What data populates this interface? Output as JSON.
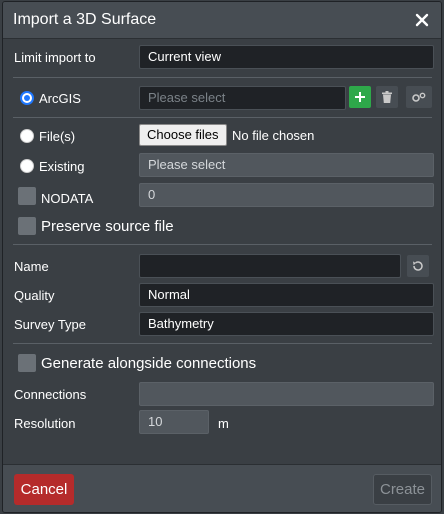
{
  "dialog": {
    "title": "Import a 3D Surface",
    "close_icon": "close-icon"
  },
  "limit_import": {
    "label": "Limit import to",
    "value": "Current view"
  },
  "source": {
    "arcgis": {
      "label": "ArcGIS",
      "placeholder": "Please select",
      "selected": true
    },
    "files": {
      "label": "File(s)",
      "choose_label": "Choose files",
      "status": "No file chosen"
    },
    "existing": {
      "label": "Existing",
      "placeholder": "Please select"
    },
    "nodata": {
      "label": "NODATA",
      "value": "0"
    },
    "preserve": {
      "label": "Preserve source file"
    }
  },
  "fields": {
    "name": {
      "label": "Name",
      "value": ""
    },
    "quality": {
      "label": "Quality",
      "value": "Normal"
    },
    "survey_type": {
      "label": "Survey Type",
      "value": "Bathymetry"
    }
  },
  "connections": {
    "generate_label": "Generate alongside connections",
    "connections_label": "Connections",
    "connections_value": "",
    "resolution_label": "Resolution",
    "resolution_value": "10",
    "resolution_unit": "m"
  },
  "footer": {
    "cancel_label": "Cancel",
    "create_label": "Create"
  },
  "colors": {
    "accent_blue": "#1f78ff",
    "add_green": "#2ea84a",
    "cancel_red": "#b52b2b"
  }
}
